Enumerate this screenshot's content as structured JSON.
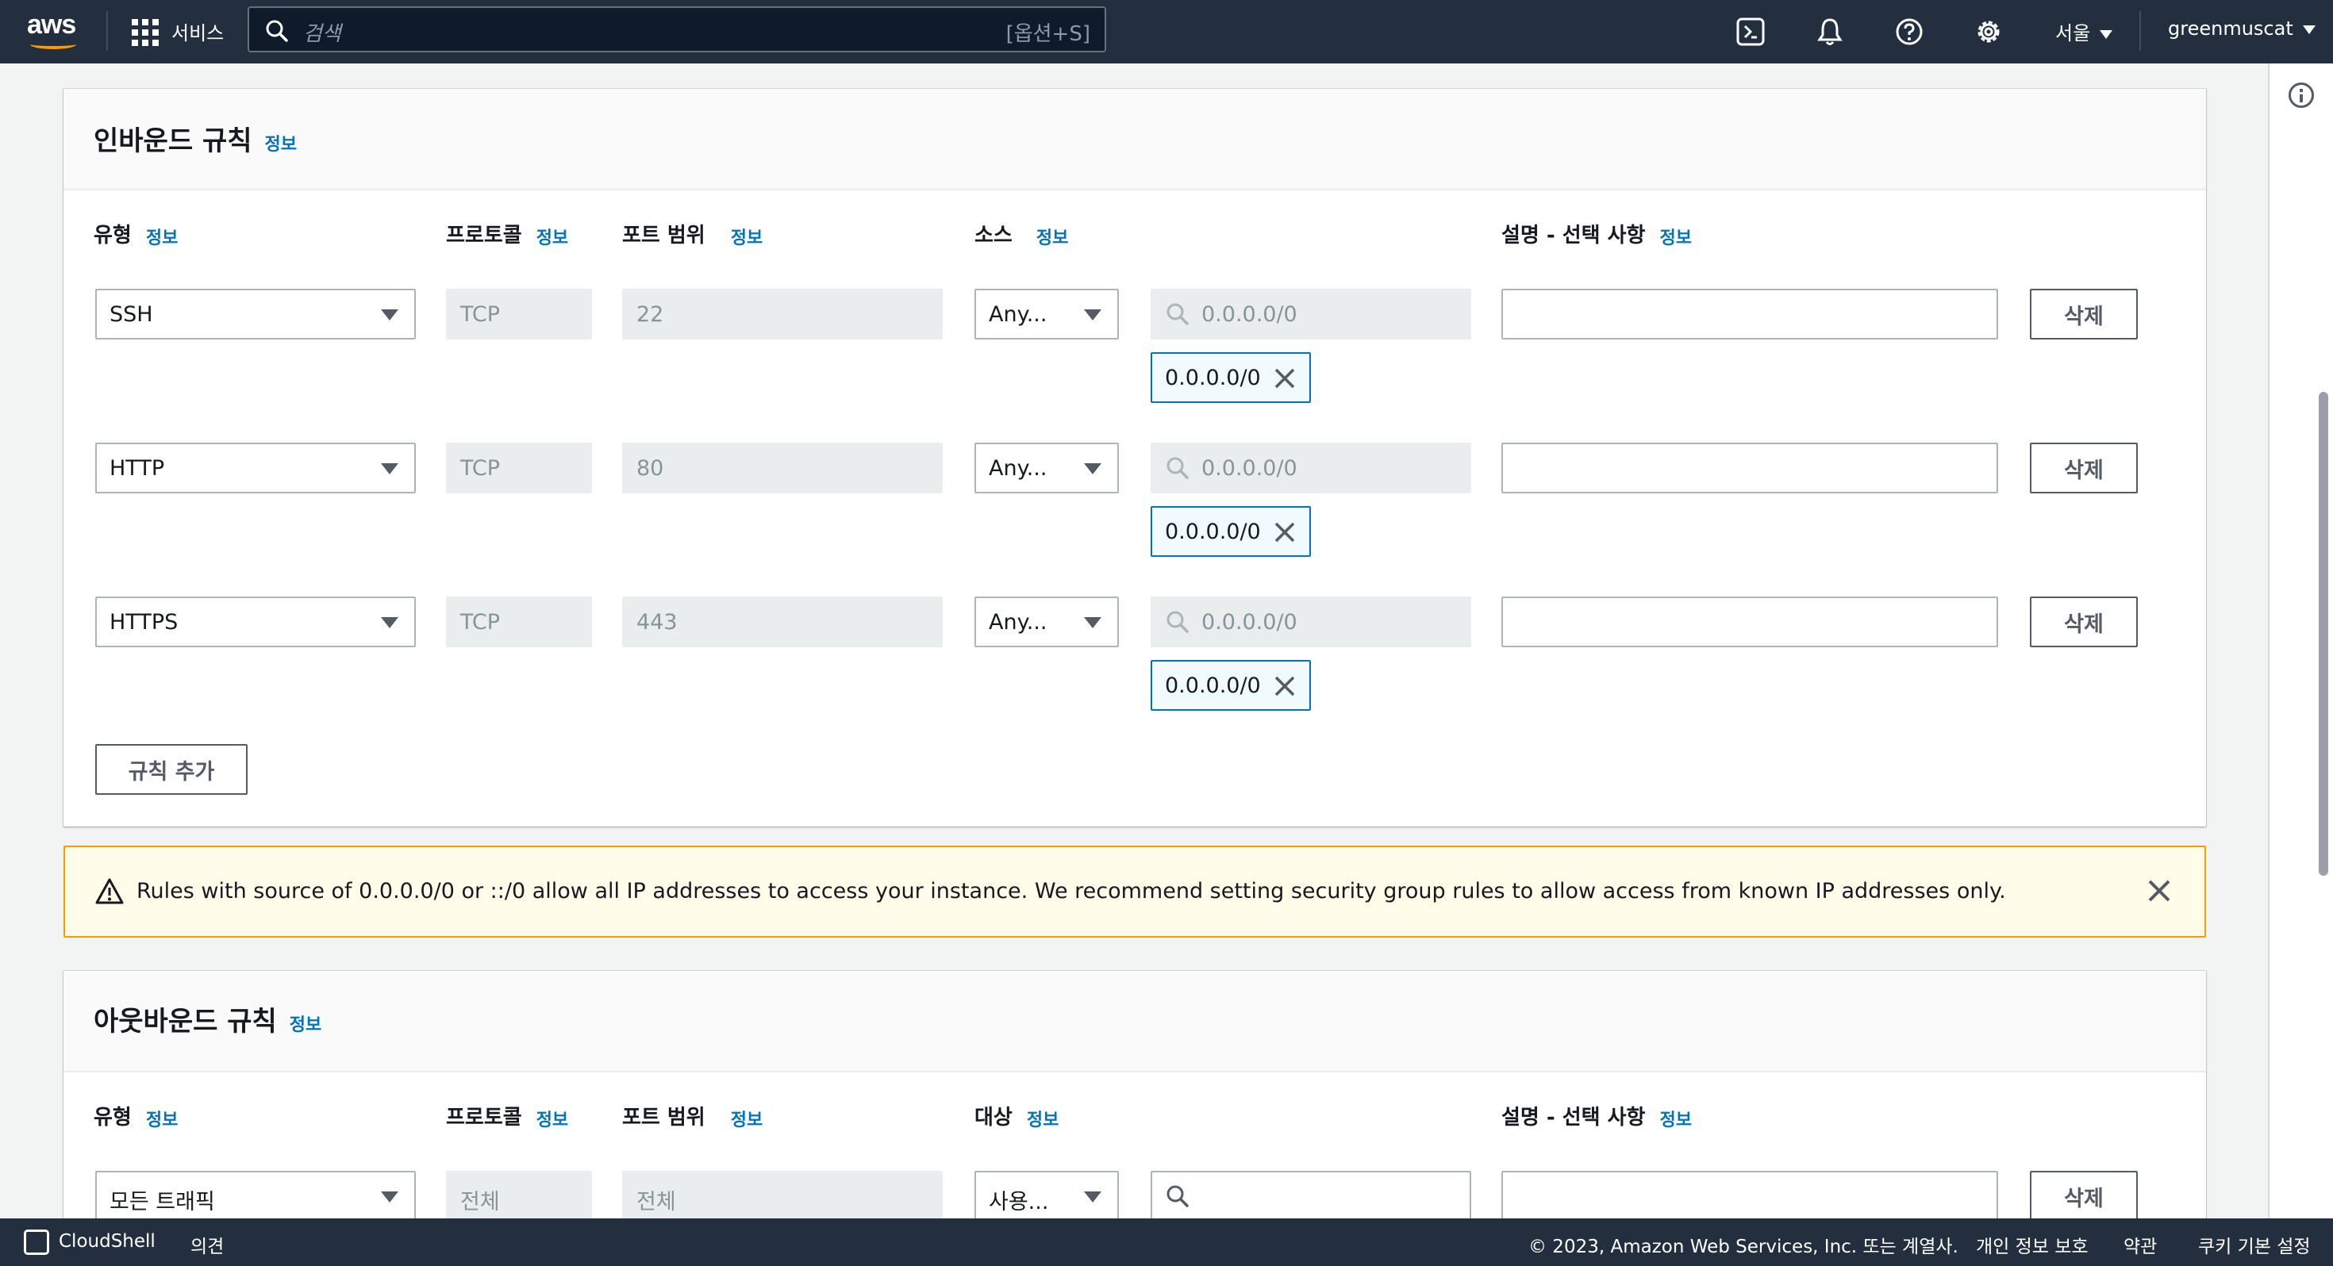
{
  "topnav": {
    "logo_text": "aws",
    "services_label": "서비스",
    "search_placeholder": "검색",
    "search_shortcut": "[옵션+S]",
    "region_label": "서울",
    "user_label": "greenmuscat"
  },
  "inbound": {
    "title": "인바운드 규칙",
    "info_label": "정보",
    "columns": {
      "type": "유형",
      "protocol": "프로토콜",
      "port_range": "포트 범위",
      "source": "소스",
      "description": "설명 - 선택 사항"
    },
    "rules": [
      {
        "type": "SSH",
        "protocol": "TCP",
        "port": "22",
        "source_type": "Any...",
        "source_placeholder": "0.0.0.0/0",
        "token": "0.0.0.0/0",
        "delete_label": "삭제"
      },
      {
        "type": "HTTP",
        "protocol": "TCP",
        "port": "80",
        "source_type": "Any...",
        "source_placeholder": "0.0.0.0/0",
        "token": "0.0.0.0/0",
        "delete_label": "삭제"
      },
      {
        "type": "HTTPS",
        "protocol": "TCP",
        "port": "443",
        "source_type": "Any...",
        "source_placeholder": "0.0.0.0/0",
        "token": "0.0.0.0/0",
        "delete_label": "삭제"
      }
    ],
    "add_rule_label": "규칙 추가"
  },
  "warning": {
    "message": "Rules with source of 0.0.0.0/0 or ::/0 allow all IP addresses to access your instance. We recommend setting security group rules to allow access from known IP addresses only."
  },
  "outbound": {
    "title": "아웃바운드 규칙",
    "info_label": "정보",
    "columns": {
      "type": "유형",
      "protocol": "프로토콜",
      "port_range": "포트 범위",
      "destination": "대상",
      "description": "설명 - 선택 사항"
    },
    "rules": [
      {
        "type": "모든 트래픽",
        "protocol": "전체",
        "port": "전체",
        "destination_type": "사용...",
        "delete_label": "삭제"
      }
    ]
  },
  "footer": {
    "cloudshell": "CloudShell",
    "feedback": "의견",
    "copyright": "© 2023, Amazon Web Services, Inc. 또는 계열사.",
    "privacy": "개인 정보 보호",
    "terms": "약관",
    "cookie": "쿠키 기본 설정"
  },
  "colors": {
    "nav_bg": "#232f3e",
    "link": "#0073bb",
    "warning_border": "#ff9900",
    "warning_bg": "#fffce9"
  }
}
